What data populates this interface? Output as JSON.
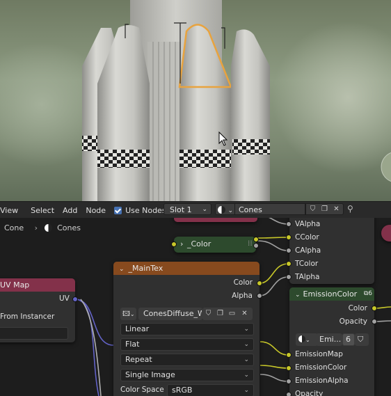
{
  "header": {
    "menus": [
      "View",
      "Select",
      "Add",
      "Node"
    ],
    "use_nodes_label": "Use Nodes",
    "slot_value": "Slot 1",
    "material_name": "Cones"
  },
  "breadcrumb": {
    "object": "Cone",
    "material": "Cones"
  },
  "nodes": {
    "color_group": {
      "label": "_Color"
    },
    "main_tex": {
      "title": "_MainTex",
      "outputs": [
        "Color",
        "Alpha"
      ],
      "image_name": "ConesDiffuse_W...",
      "interpolation": "Linear",
      "projection": "Flat",
      "extension": "Repeat",
      "source": "Single Image",
      "color_space_label": "Color Space",
      "color_space": "sRGB"
    },
    "uv_map": {
      "title": "UV Map",
      "output": "UV",
      "from_instancer": "From Instancer"
    },
    "group_outputs": [
      "VAlpha",
      "CColor",
      "CAlpha",
      "TColor",
      "TAlpha"
    ],
    "emission_color": {
      "title": "EmissionColor",
      "badge": "6",
      "outputs": [
        "Color",
        "Opacity"
      ],
      "material_short": "Emi...",
      "users": "6",
      "inputs": [
        "EmissionMap",
        "EmissionColor",
        "EmissionAlpha",
        "Opacity"
      ]
    }
  },
  "colors": {
    "accent_blue": "#4772b3",
    "texture_header": "#874a1e",
    "input_header": "#83314a",
    "group_header": "#2d4a2d",
    "socket_yellow": "#c7c729",
    "socket_gray": "#a1a1a1",
    "socket_purple": "#6363c7",
    "selection_orange": "#e8a33e"
  }
}
